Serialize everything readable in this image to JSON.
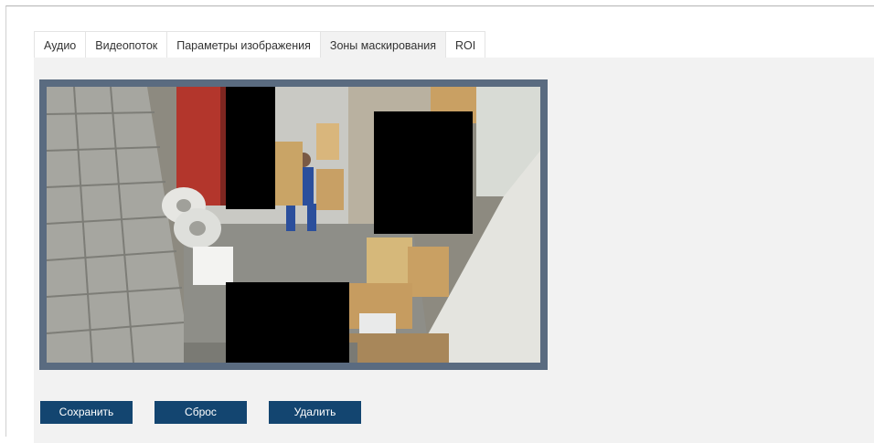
{
  "tabs": [
    {
      "label": "Аудио",
      "active": false
    },
    {
      "label": "Видеопоток",
      "active": false
    },
    {
      "label": "Параметры изображения",
      "active": false
    },
    {
      "label": "Зоны маскирования",
      "active": true
    },
    {
      "label": "ROI",
      "active": false
    }
  ],
  "video": {
    "mask_zone_count": 3
  },
  "buttons": {
    "save_label": "Сохранить",
    "reset_label": "Сброс",
    "delete_label": "Удалить"
  },
  "colors": {
    "button_bg": "#134570",
    "content_bg": "#f2f2f2",
    "video_border": "#5a6b80",
    "mask": "#000000"
  }
}
